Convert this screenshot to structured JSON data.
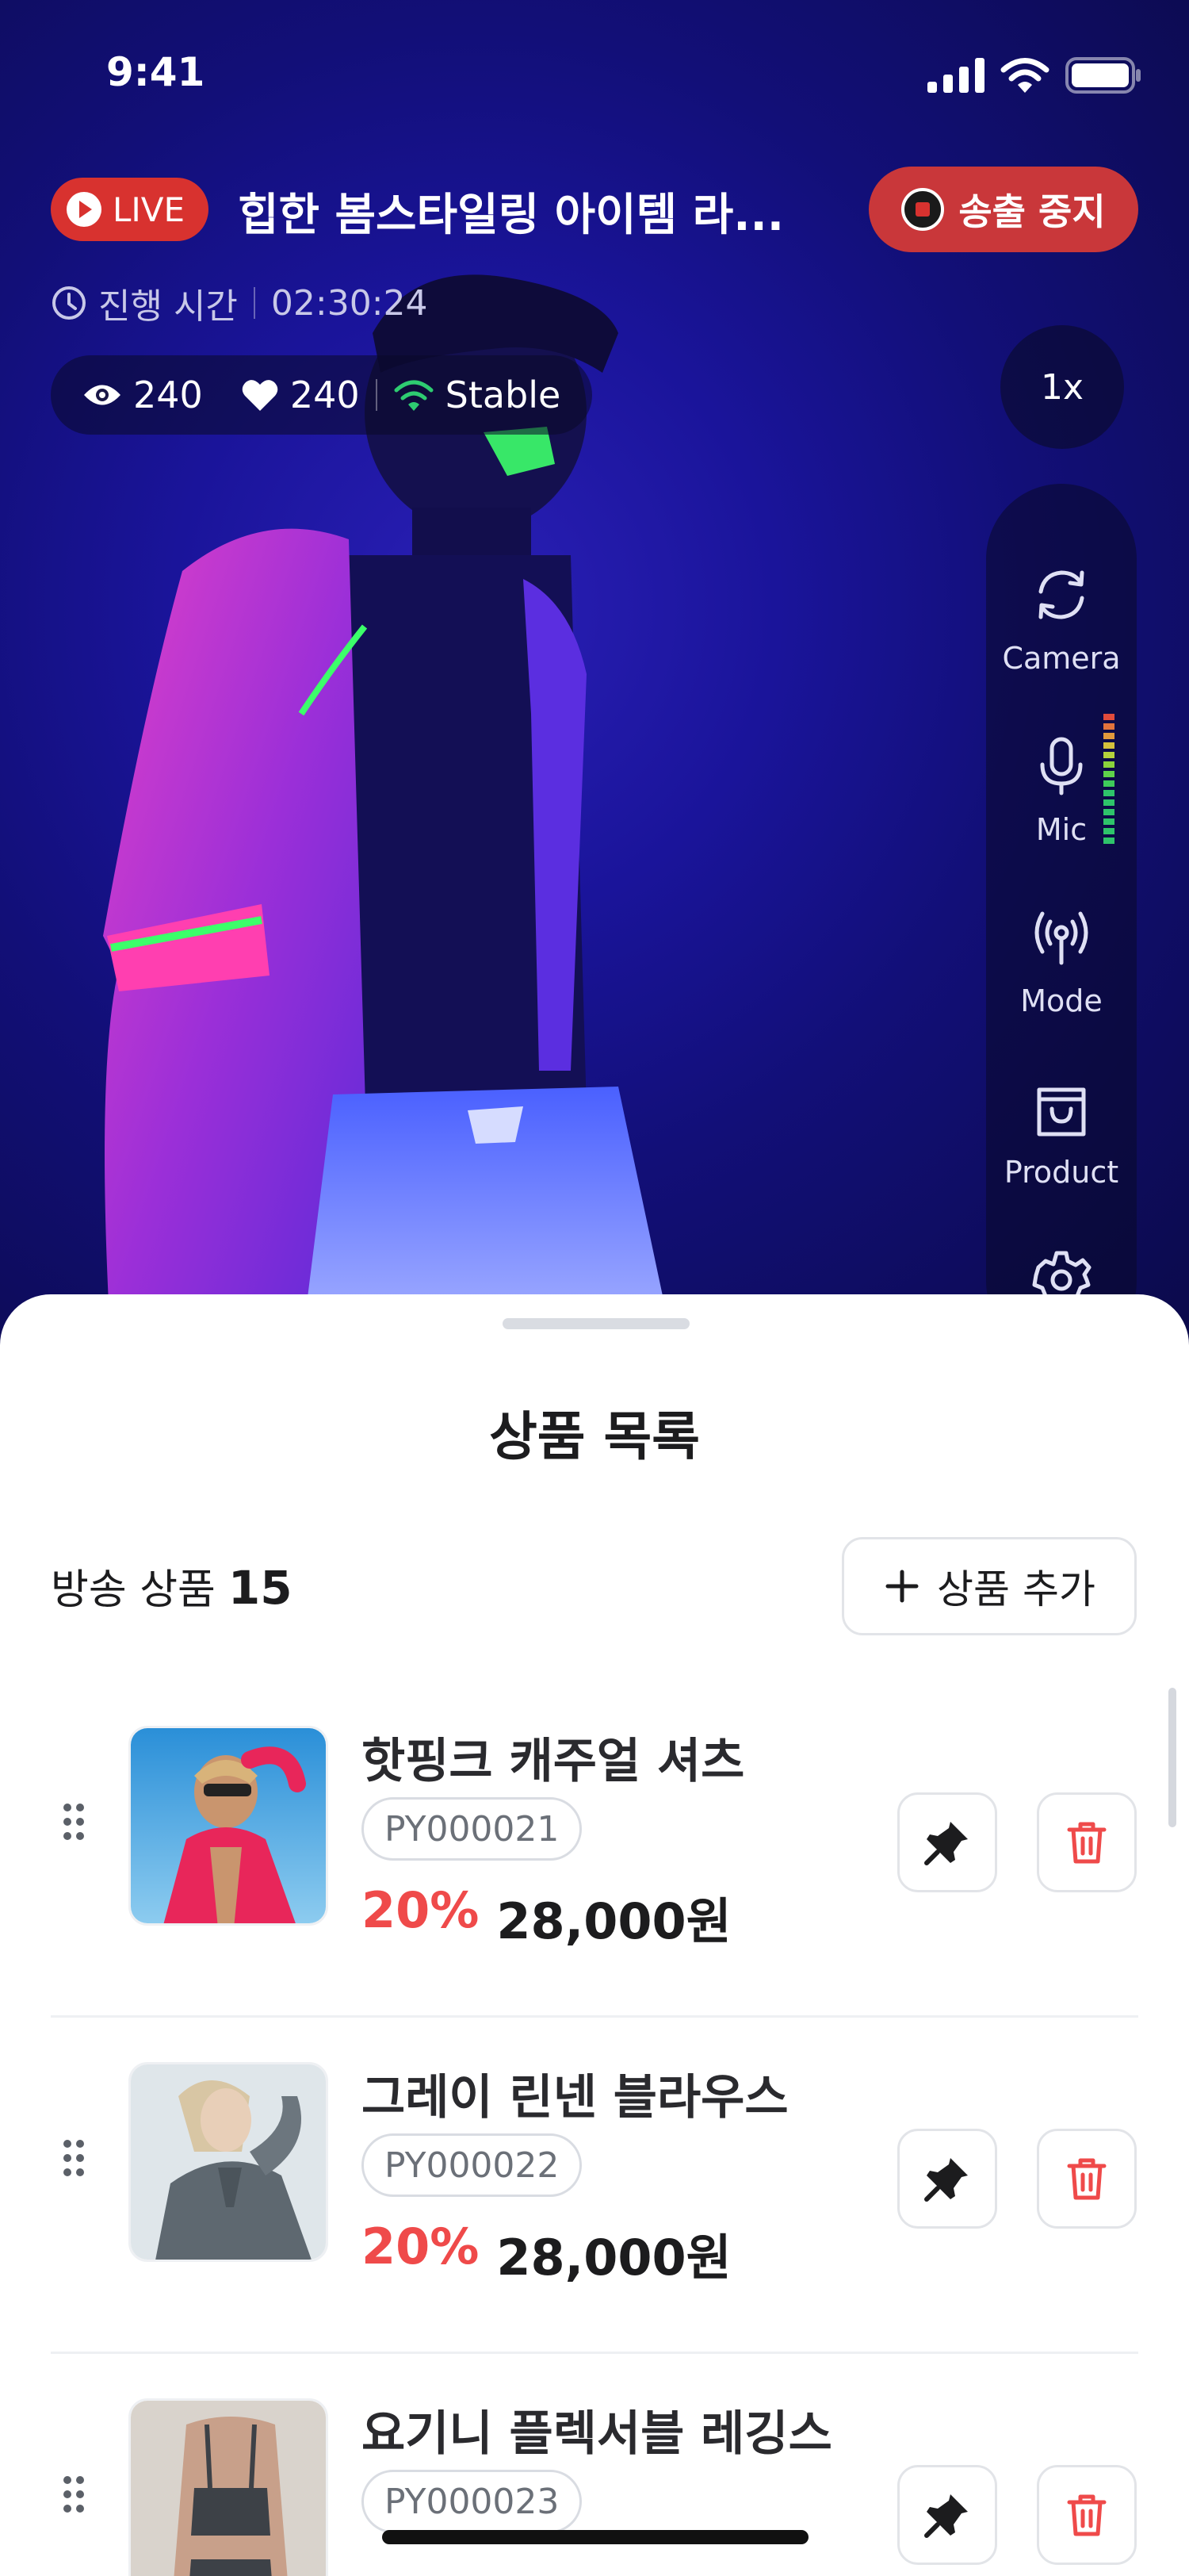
{
  "status_bar": {
    "time": "9:41"
  },
  "live": {
    "badge_label": "LIVE",
    "title": "힙한 봄스타일링 아이템 라...",
    "stop_label": "송출 중지",
    "elapsed_label": "진행 시간",
    "elapsed_value": "02:30:24",
    "viewers": "240",
    "likes": "240",
    "connection": "Stable",
    "speed": "1x"
  },
  "controls": [
    {
      "label": "Camera",
      "icon": "camera-switch-icon"
    },
    {
      "label": "Mic",
      "icon": "mic-icon"
    },
    {
      "label": "Mode",
      "icon": "broadcast-icon"
    },
    {
      "label": "Product",
      "icon": "shopping-bag-icon"
    },
    {
      "label": "",
      "icon": "settings-icon"
    }
  ],
  "sheet": {
    "title": "상품 목록",
    "count_label": "방송 상품",
    "count_value": "15",
    "add_label": "상품 추가",
    "products": [
      {
        "name": "핫핑크 캐주얼 셔츠",
        "code": "PY000021",
        "discount": "20%",
        "price": "28,000원"
      },
      {
        "name": "그레이 린넨 블라우스",
        "code": "PY000022",
        "discount": "20%",
        "price": "28,000원"
      },
      {
        "name": "요기니 플렉서블 레깅스",
        "code": "PY000023",
        "discount": "",
        "price": ""
      }
    ]
  },
  "colors": {
    "live_red": "#d8322f",
    "discount_red": "#ef4a4a",
    "stable_green": "#2ecc71",
    "video_blue": "#1a149a"
  }
}
